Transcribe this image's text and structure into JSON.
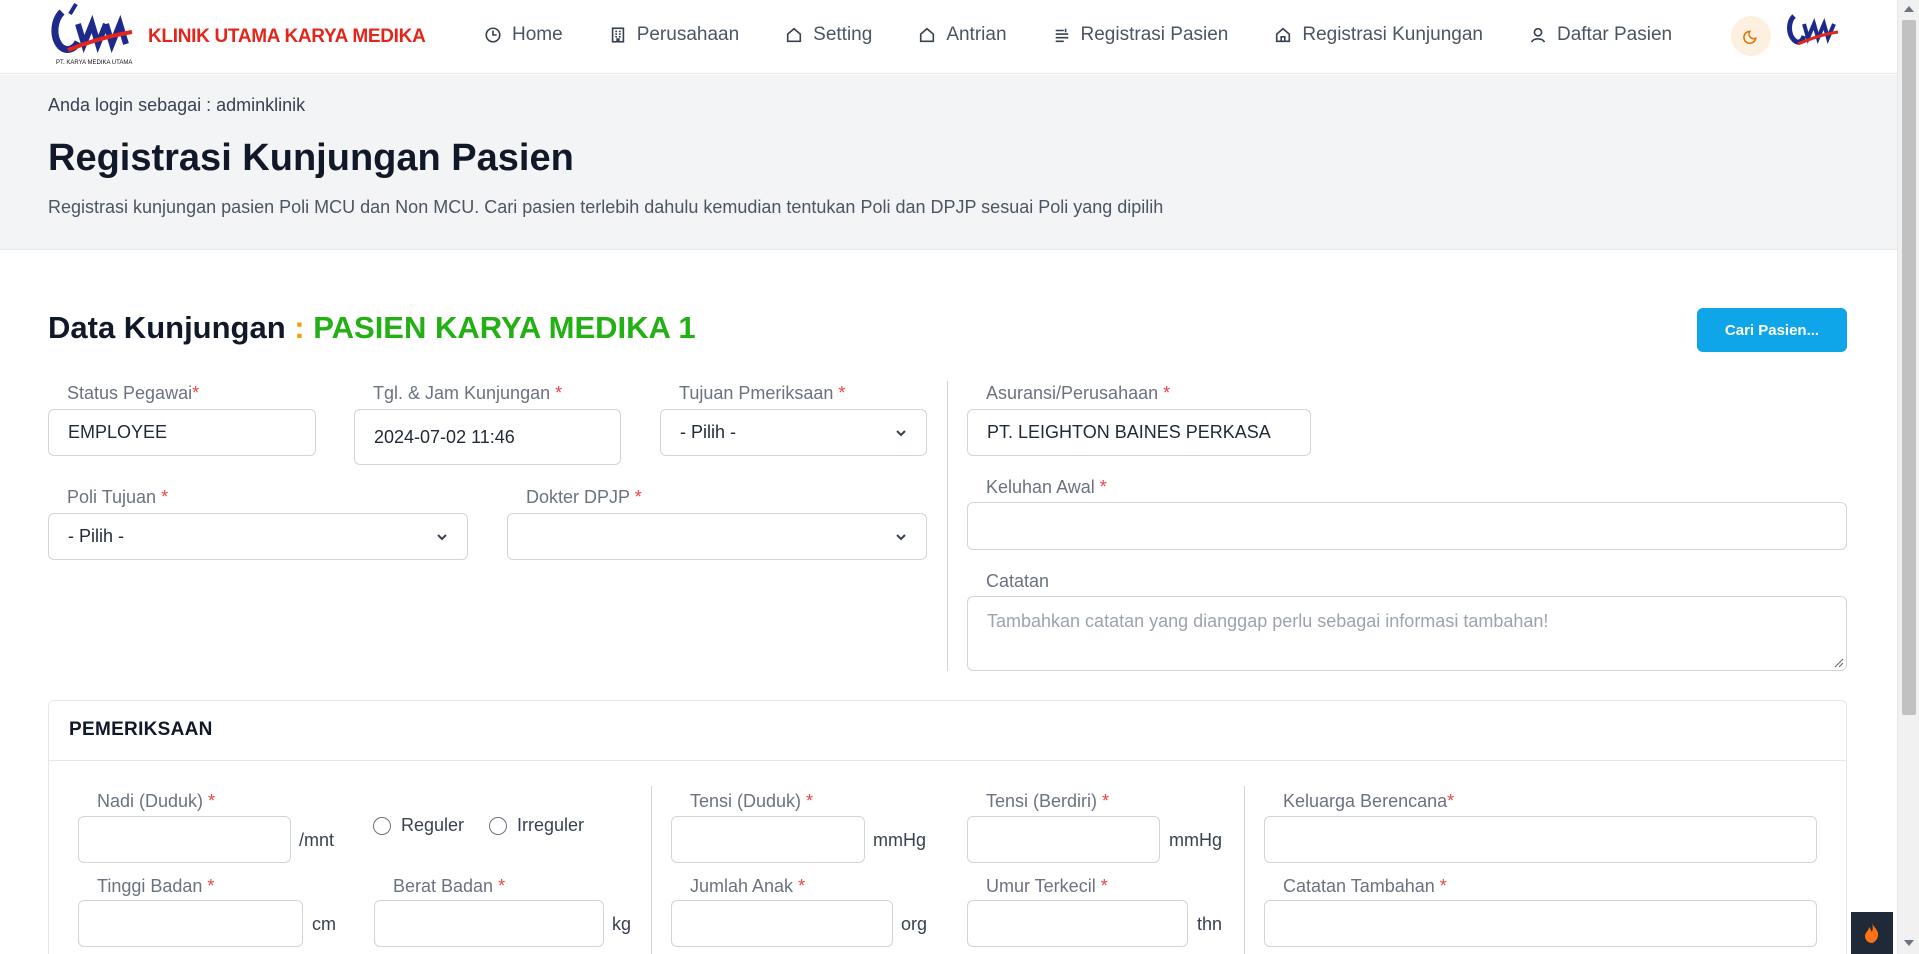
{
  "navbar": {
    "brand_name": "KLINIK UTAMA KARYA MEDIKA",
    "logo_caption": "PT. KARYA MEDIKA UTAMA",
    "items": [
      {
        "label": "Home",
        "icon": "clock-icon"
      },
      {
        "label": "Perusahaan",
        "icon": "building-icon"
      },
      {
        "label": "Setting",
        "icon": "tag-icon"
      },
      {
        "label": "Antrian",
        "icon": "tag-icon"
      },
      {
        "label": "Registrasi Pasien",
        "icon": "list-icon"
      },
      {
        "label": "Registrasi Kunjungan",
        "icon": "home-icon"
      },
      {
        "label": "Daftar Pasien",
        "icon": "user-icon"
      }
    ],
    "theme_icon": "moon-icon"
  },
  "header": {
    "login_info": "Anda login sebagai : adminklinik",
    "title": "Registrasi Kunjungan Pasien",
    "description": "Registrasi kunjungan pasien Poli MCU dan Non MCU. Cari pasien terlebih dahulu kemudian tentukan Poli dan DPJP sesuai Poli yang dipilih"
  },
  "visit": {
    "title": "Data Kunjungan",
    "colon": ":",
    "patient_name": "PASIEN KARYA MEDIKA 1",
    "search_button": "Cari Pasien...",
    "fields": {
      "status_pegawai": {
        "label": "Status Pegawai",
        "value": "EMPLOYEE"
      },
      "tgl_jam": {
        "label": "Tgl. & Jam Kunjungan ",
        "value": "2024-07-02 11:46"
      },
      "tujuan": {
        "label": "Tujuan Pmeriksaan ",
        "value": "- Pilih -"
      },
      "asuransi": {
        "label": "Asuransi/Perusahaan ",
        "value": "PT. LEIGHTON BAINES PERKASA"
      },
      "poli": {
        "label": "Poli Tujuan ",
        "value": "- Pilih -"
      },
      "dokter": {
        "label": "Dokter DPJP ",
        "value": ""
      },
      "keluhan": {
        "label": "Keluhan Awal ",
        "value": ""
      },
      "catatan": {
        "label": "Catatan",
        "placeholder": "Tambahkan catatan yang dianggap perlu sebagai informasi tambahan!"
      }
    },
    "required_mark": "*"
  },
  "exam": {
    "title": "PEMERIKSAAN",
    "nadi": {
      "label": "Nadi (Duduk) ",
      "unit": "/mnt"
    },
    "radio_reguler": "Reguler",
    "radio_irreguler": "Irreguler",
    "tensi_duduk": {
      "label": "Tensi (Duduk) ",
      "unit": "mmHg"
    },
    "tensi_berdiri": {
      "label": "Tensi (Berdiri) ",
      "unit": "mmHg"
    },
    "kb": {
      "label": "Keluarga Berencana"
    },
    "tinggi": {
      "label": "Tinggi Badan ",
      "unit": "cm"
    },
    "berat": {
      "label": "Berat Badan ",
      "unit": "kg"
    },
    "anak": {
      "label": "Jumlah Anak ",
      "unit": "org"
    },
    "umur": {
      "label": "Umur Terkecil ",
      "unit": "thn"
    },
    "catatan_tambahan": {
      "label": "Catatan Tambahan "
    }
  },
  "colors": {
    "brand": "#e3261c",
    "primary": "#0ea5e9",
    "patient": "#22b014",
    "required": "#ef4444"
  }
}
